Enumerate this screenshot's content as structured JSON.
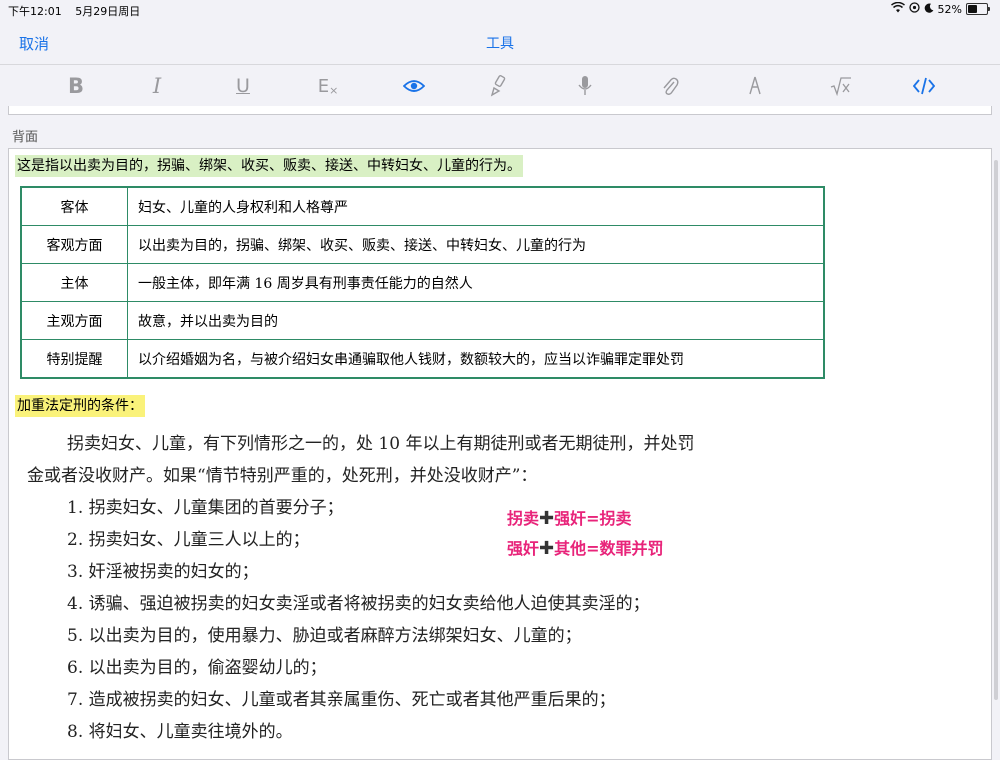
{
  "status": {
    "time": "下午12:01",
    "date": "5月29日周日",
    "battery": "52%",
    "battery_level": 0.52
  },
  "nav": {
    "cancel": "取消",
    "title": "工具"
  },
  "toolbar": {
    "bold": "B",
    "italic": "I",
    "underline": "U",
    "clear_format": "E",
    "icons": [
      "eye-icon",
      "brush-icon",
      "mic-icon",
      "paperclip-icon",
      "pen-icon",
      "sqrt-icon",
      "code-icon"
    ],
    "active": [
      "eye-icon",
      "code-icon"
    ]
  },
  "colors": {
    "accent": "#1a73e8",
    "highlight_green": "#d9f0c4",
    "highlight_yellow": "#faf27a",
    "table_border": "#2e8b66",
    "annotation": "#e8247a"
  },
  "back_label": "背面",
  "definition": "这是指以出卖为目的，拐骗、绑架、收买、贩卖、接送、中转妇女、儿童的行为。",
  "table": [
    {
      "key": "客体",
      "value": "妇女、儿童的人身权利和人格尊严"
    },
    {
      "key": "客观方面",
      "value": "以出卖为目的，拐骗、绑架、收买、贩卖、接送、中转妇女、儿童的行为"
    },
    {
      "key": "主体",
      "value": "一般主体，即年满 16 周岁具有刑事责任能力的自然人"
    },
    {
      "key": "主观方面",
      "value": "故意，并以出卖为目的"
    },
    {
      "key": "特别提醒",
      "value": "以介绍婚姻为名，与被介绍妇女串通骗取他人钱财，数额较大的，应当以诈骗罪定罪处罚"
    }
  ],
  "aggravating_label": "加重法定刑的条件：",
  "paragraph_line1": "拐卖妇女、儿童，有下列情形之一的，处 10 年以上有期徒刑或者无期徒刑，并处罚",
  "paragraph_line2": "金或者没收财产。如果“情节特别严重的，处死刑，并处没收财产”：",
  "items": [
    "1. 拐卖妇女、儿童集团的首要分子；",
    "2. 拐卖妇女、儿童三人以上的；",
    "3. 奸淫被拐卖的妇女的；",
    "4. 诱骗、强迫被拐卖的妇女卖淫或者将被拐卖的妇女卖给他人迫使其卖淫的；",
    "5. 以出卖为目的，使用暴力、胁迫或者麻醉方法绑架妇女、儿童的；",
    "6. 以出卖为目的，偷盗婴幼儿的；",
    "7. 造成被拐卖的妇女、儿童或者其亲属重伤、死亡或者其他严重后果的；",
    "8. 将妇女、儿童卖往境外的。"
  ],
  "annotations": [
    {
      "a": "拐卖",
      "plus": "✚",
      "b": "强奸=拐卖"
    },
    {
      "a": "强奸",
      "plus": "✚",
      "b": "其他=数罪并罚"
    }
  ]
}
